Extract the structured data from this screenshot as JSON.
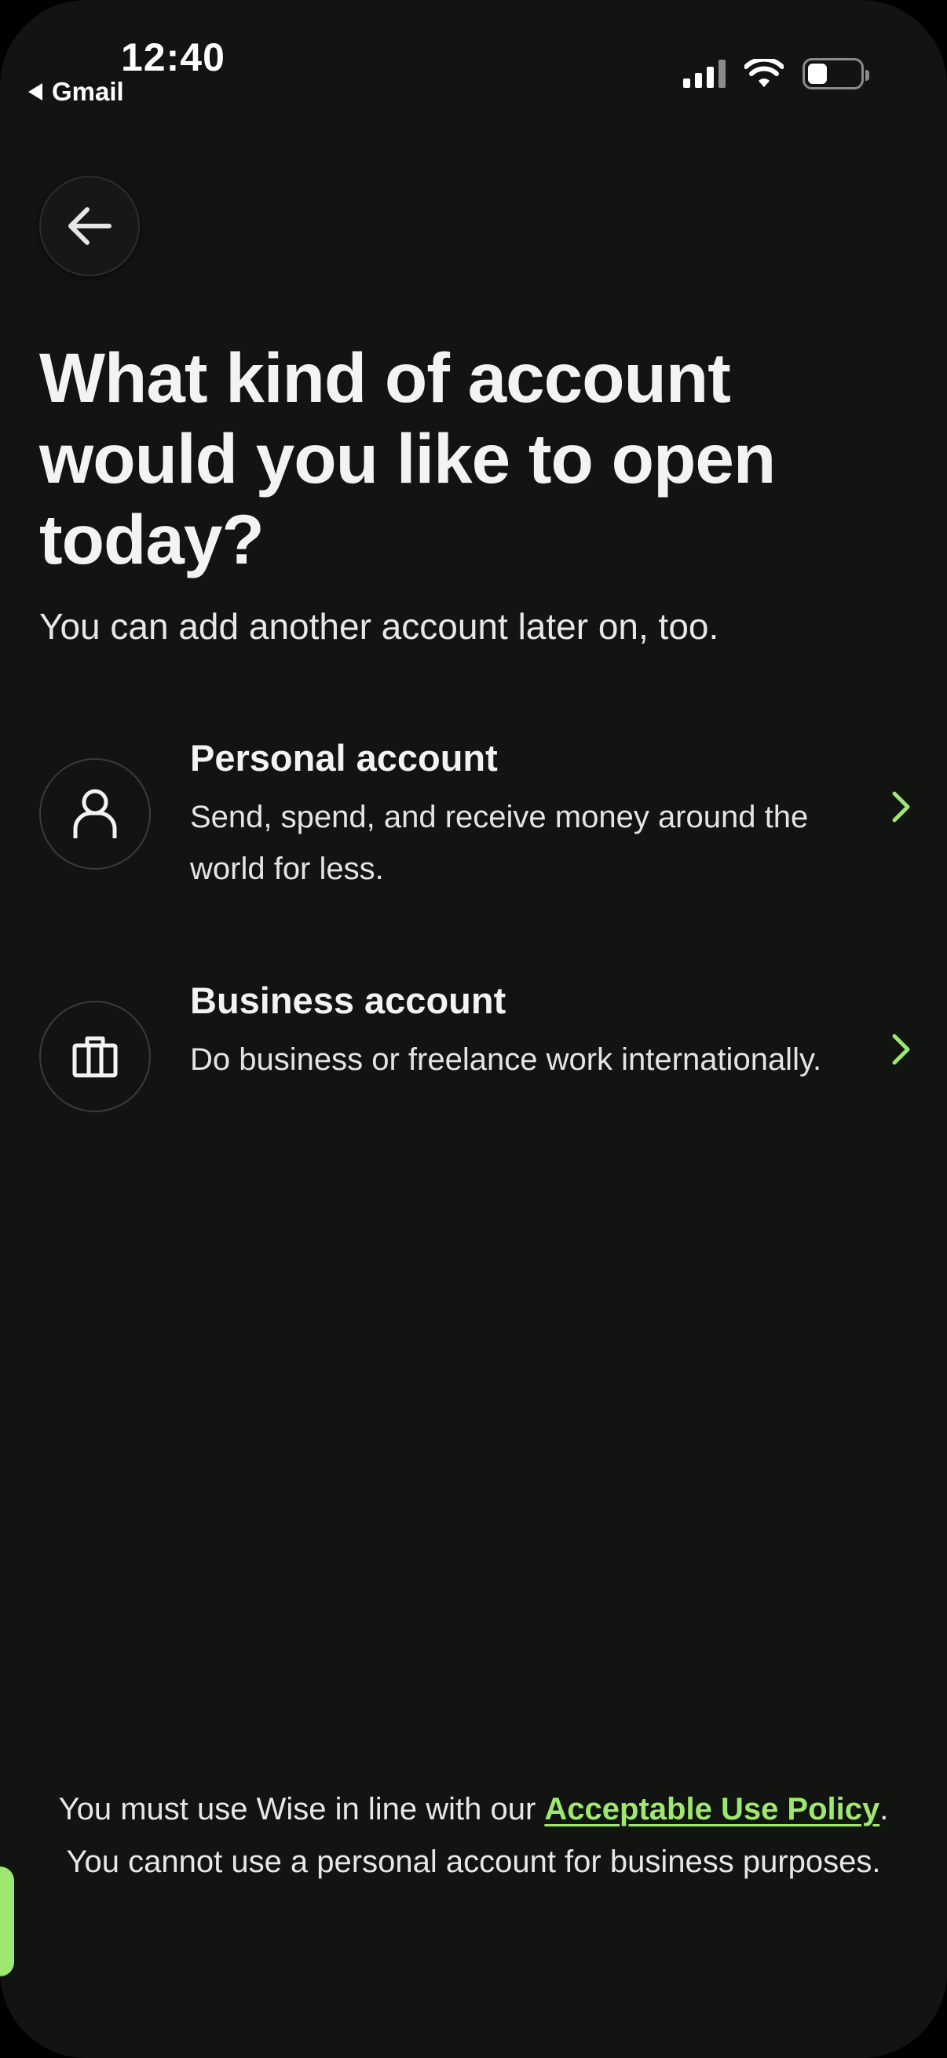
{
  "status_bar": {
    "time": "12:40",
    "back_app": "Gmail",
    "icons": [
      "cellular-signal-icon",
      "wifi-icon",
      "battery-icon"
    ]
  },
  "header": {
    "back_button_icon": "arrow-left-icon"
  },
  "main": {
    "title": "What kind of account would you like to open today?",
    "subtitle": "You can add another account later on, too.",
    "options": [
      {
        "icon": "person-icon",
        "title": "Personal account",
        "description": "Send, spend, and receive money around the world for less.",
        "chevron_icon": "chevron-right-icon"
      },
      {
        "icon": "briefcase-icon",
        "title": "Business account",
        "description": "Do business or freelance work internationally.",
        "chevron_icon": "chevron-right-icon"
      }
    ]
  },
  "footer": {
    "text_before": "You must use Wise in line with our ",
    "link_text": "Acceptable Use Policy",
    "text_after": ". You cannot use a personal account for business purposes."
  },
  "colors": {
    "background": "#121412",
    "text": "#f3f3f1",
    "accent": "#9fe870",
    "border": "#3a3c3a"
  }
}
